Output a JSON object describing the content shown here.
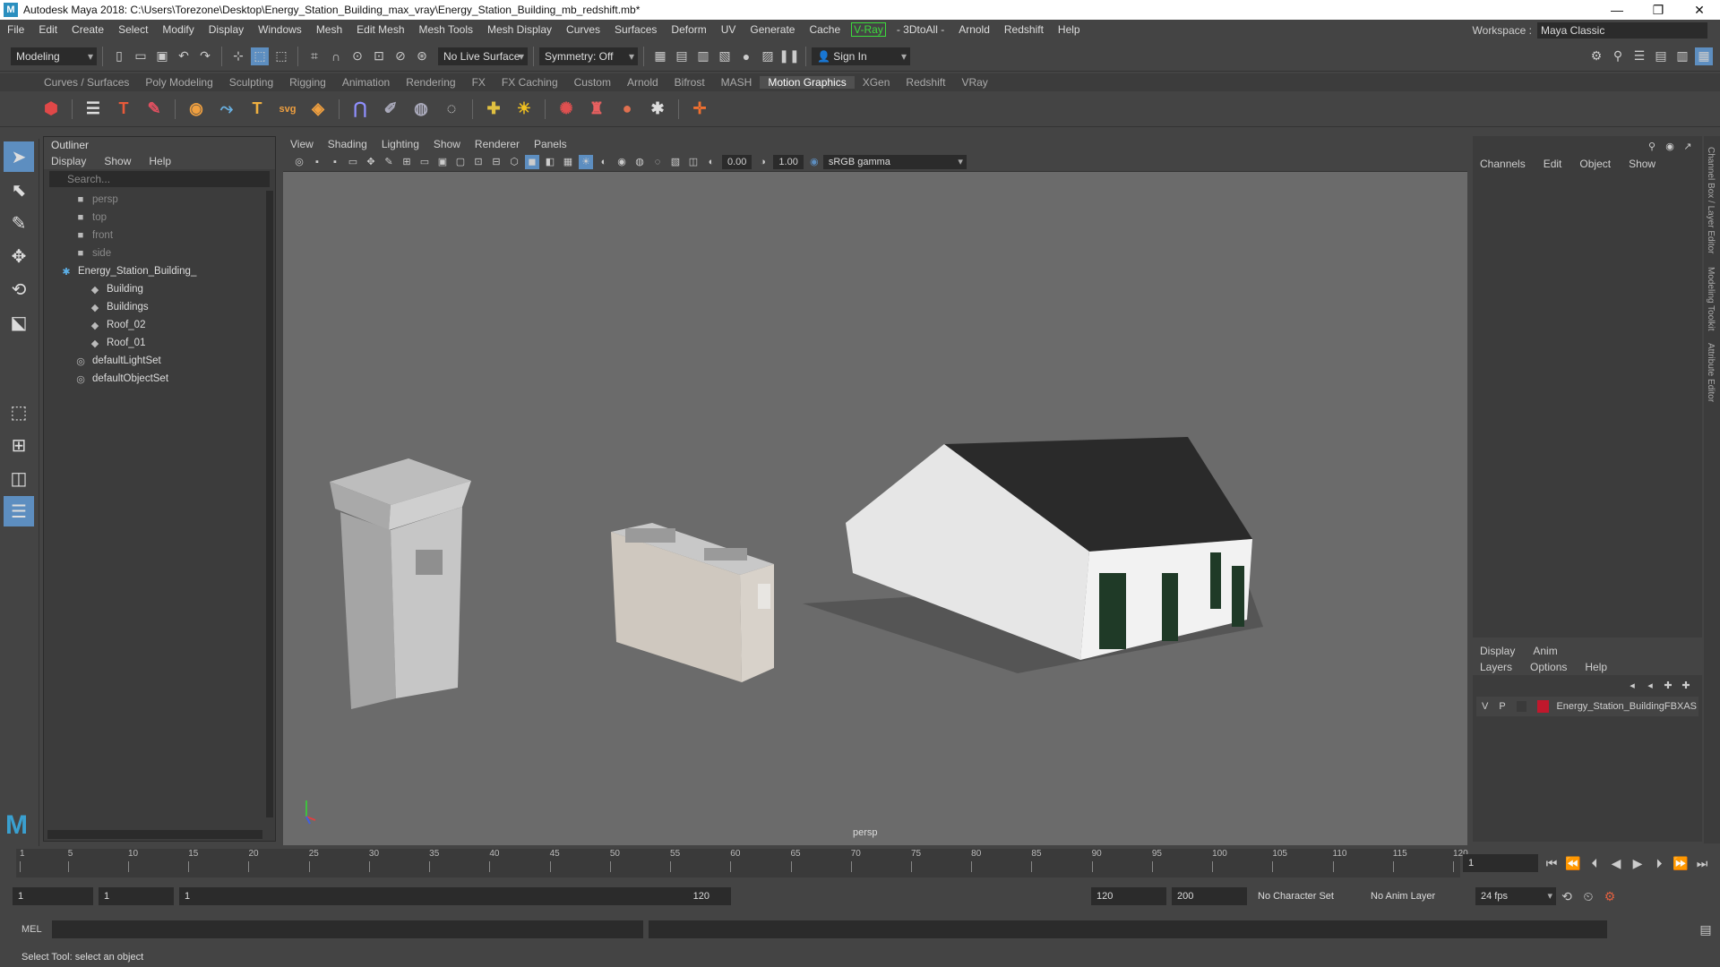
{
  "window": {
    "title": "Autodesk Maya 2018: C:\\Users\\Torezone\\Desktop\\Energy_Station_Building_max_vray\\Energy_Station_Building_mb_redshift.mb*",
    "min": "—",
    "max": "❐",
    "close": "✕"
  },
  "menubar": {
    "items": [
      "File",
      "Edit",
      "Create",
      "Select",
      "Modify",
      "Display",
      "Windows",
      "Mesh",
      "Edit Mesh",
      "Mesh Tools",
      "Mesh Display",
      "Curves",
      "Surfaces",
      "Deform",
      "UV",
      "Generate",
      "Cache"
    ],
    "vray": "V-Ray",
    "items2": [
      "- 3DtoAll -",
      "Arnold",
      "Redshift",
      "Help"
    ]
  },
  "workspace": {
    "label": "Workspace :",
    "value": "Maya Classic"
  },
  "statusline": {
    "mode": "Modeling",
    "live_surface": "No Live Surface",
    "symmetry": "Symmetry: Off",
    "sign_in": "Sign In"
  },
  "shelf_tabs": [
    "Curves / Surfaces",
    "Poly Modeling",
    "Sculpting",
    "Rigging",
    "Animation",
    "Rendering",
    "FX",
    "FX Caching",
    "Custom",
    "Arnold",
    "Bifrost",
    "MASH",
    "Motion Graphics",
    "XGen",
    "Redshift",
    "VRay"
  ],
  "shelf_active": "Motion Graphics",
  "outliner": {
    "title": "Outliner",
    "menu": [
      "Display",
      "Show",
      "Help"
    ],
    "search_placeholder": "Search...",
    "items": [
      {
        "label": "persp",
        "dim": true,
        "indent": 1,
        "icon": "camera-icon"
      },
      {
        "label": "top",
        "dim": true,
        "indent": 1,
        "icon": "camera-icon"
      },
      {
        "label": "front",
        "dim": true,
        "indent": 1,
        "icon": "camera-icon"
      },
      {
        "label": "side",
        "dim": true,
        "indent": 1,
        "icon": "camera-icon"
      },
      {
        "label": "Energy_Station_Building_",
        "dim": false,
        "indent": 0,
        "icon": "group-icon"
      },
      {
        "label": "Building",
        "dim": false,
        "indent": 2,
        "icon": "mesh-icon"
      },
      {
        "label": "Buildings",
        "dim": false,
        "indent": 2,
        "icon": "mesh-icon"
      },
      {
        "label": "Roof_02",
        "dim": false,
        "indent": 2,
        "icon": "mesh-icon"
      },
      {
        "label": "Roof_01",
        "dim": false,
        "indent": 2,
        "icon": "mesh-icon"
      },
      {
        "label": "defaultLightSet",
        "dim": false,
        "indent": 1,
        "icon": "set-icon"
      },
      {
        "label": "defaultObjectSet",
        "dim": false,
        "indent": 1,
        "icon": "set-icon"
      }
    ]
  },
  "viewport": {
    "menu": [
      "View",
      "Shading",
      "Lighting",
      "Show",
      "Renderer",
      "Panels"
    ],
    "exposure": "0.00",
    "gamma": "1.00",
    "color_space": "sRGB gamma",
    "camera": "persp"
  },
  "channelbox": {
    "menu": [
      "Channels",
      "Edit",
      "Object",
      "Show"
    ]
  },
  "layers": {
    "tabs": [
      "Display",
      "Anim"
    ],
    "menu": [
      "Layers",
      "Options",
      "Help"
    ],
    "row": {
      "v": "V",
      "p": "P",
      "name": "Energy_Station_BuildingFBXAS",
      "color": "#c0182c"
    }
  },
  "side_tabs": [
    "Channel Box / Layer Editor",
    "Modeling Toolkit",
    "Attribute Editor"
  ],
  "timeline": {
    "ticks": [
      "1",
      "5",
      "10",
      "15",
      "20",
      "25",
      "30",
      "35",
      "40",
      "45",
      "50",
      "55",
      "60",
      "65",
      "70",
      "75",
      "80",
      "85",
      "90",
      "95",
      "100",
      "105",
      "110",
      "115",
      "120"
    ],
    "current": "1"
  },
  "range": {
    "start": "1",
    "playstart": "1",
    "slider_start": "1",
    "slider_end": "120",
    "playend": "120",
    "end": "200",
    "character_set": "No Character Set",
    "anim_layer": "No Anim Layer",
    "fps": "24 fps"
  },
  "mel": {
    "label": "MEL"
  },
  "helpline": "Select Tool: select an object"
}
